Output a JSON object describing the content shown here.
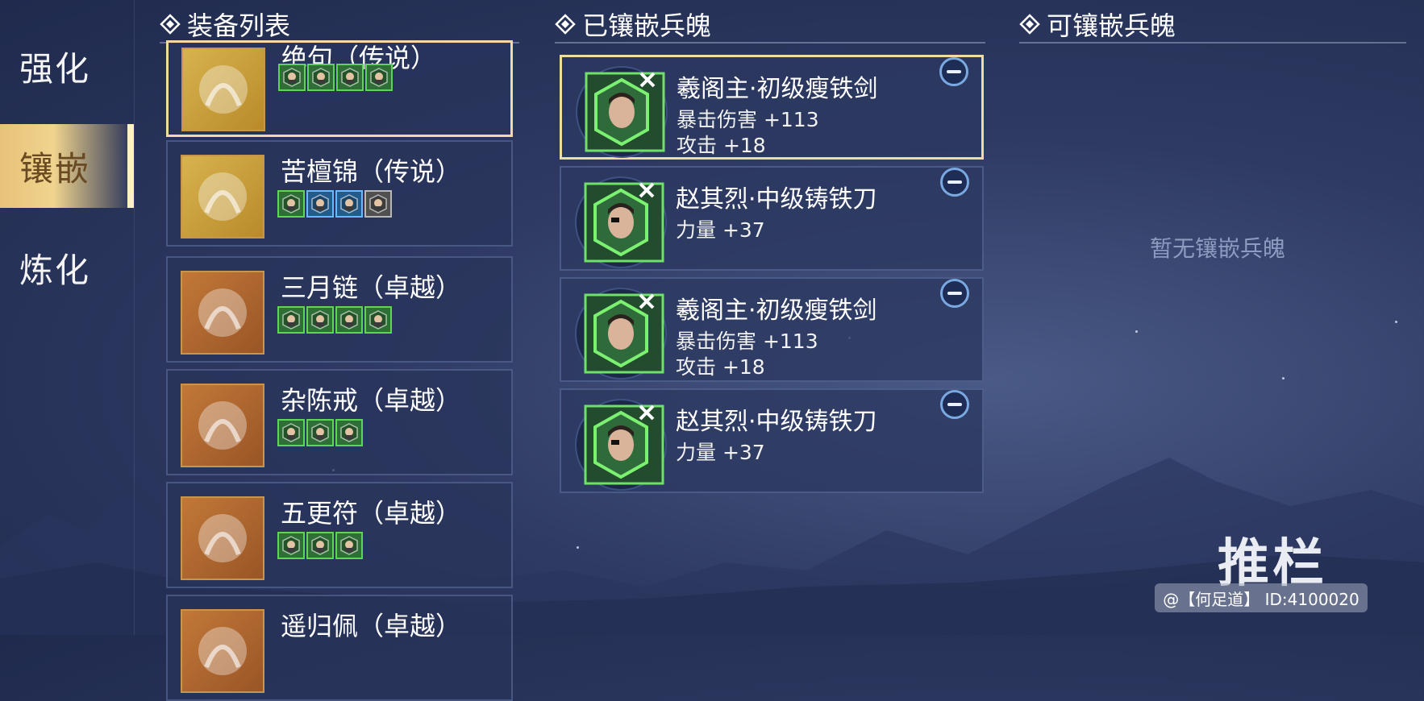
{
  "nav": {
    "items": [
      {
        "label": "强化",
        "active": false
      },
      {
        "label": "镶嵌",
        "active": true
      },
      {
        "label": "炼化",
        "active": false
      }
    ]
  },
  "headers": {
    "equipment_list": "装备列表",
    "embedded": "已镶嵌兵魄",
    "available": "可镶嵌兵魄"
  },
  "equipment": [
    {
      "name": "绝句（传说）",
      "slot_colors": [
        "green",
        "green",
        "green",
        "green"
      ]
    },
    {
      "name": "苦檀锦（传说）",
      "slot_colors": [
        "green",
        "blue",
        "blue",
        "grey"
      ]
    },
    {
      "name": "三月链（卓越）",
      "slot_colors": [
        "green",
        "green",
        "green",
        "green"
      ]
    },
    {
      "name": "杂陈戒（卓越）",
      "slot_colors": [
        "green",
        "green",
        "green"
      ]
    },
    {
      "name": "五更符（卓越）",
      "slot_colors": [
        "green",
        "green",
        "green"
      ]
    },
    {
      "name": "遥归佩（卓越）",
      "slot_colors": []
    }
  ],
  "embedded": [
    {
      "name": "羲阁主·初级瘦铁剑",
      "stats": [
        "暴击伤害 +113",
        "攻击 +18"
      ],
      "portrait": "young-swordsman"
    },
    {
      "name": "赵其烈·中级铸铁刀",
      "stats": [
        "力量 +37"
      ],
      "portrait": "eyepatch-warrior"
    },
    {
      "name": "羲阁主·初级瘦铁剑",
      "stats": [
        "暴击伤害 +113",
        "攻击 +18"
      ],
      "portrait": "young-swordsman"
    },
    {
      "name": "赵其烈·中级铸铁刀",
      "stats": [
        "力量 +37"
      ],
      "portrait": "eyepatch-warrior"
    }
  ],
  "available_empty_text": "暂无镶嵌兵魄",
  "logo_text": "推栏",
  "watermark": "@【何足道】 ID:4100020",
  "colors": {
    "accent_gold": "#f2dba2",
    "slot_green": "#5fd45a",
    "slot_blue": "#68b9ff"
  }
}
